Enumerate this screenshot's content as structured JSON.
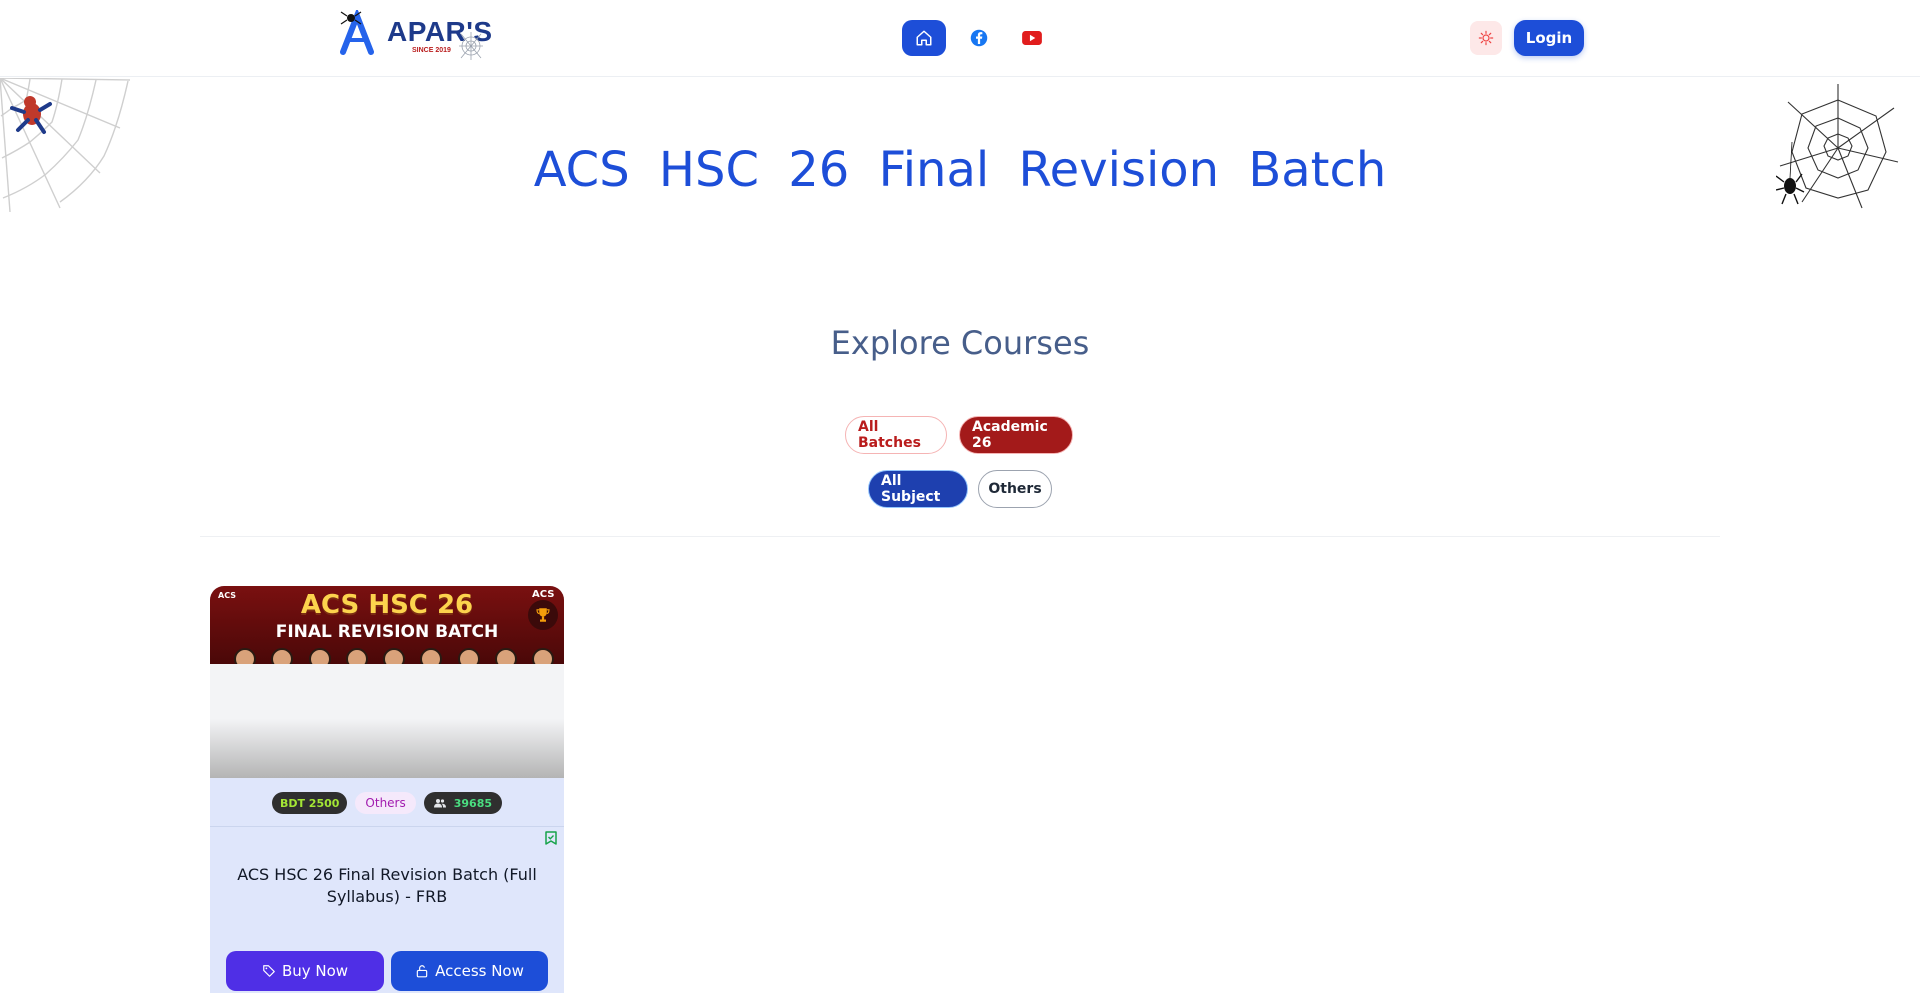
{
  "header": {
    "logo_text": "APAR'S",
    "logo_since": "SINCE 2019",
    "login_label": "Login",
    "nav_icons": [
      "home-icon",
      "facebook-icon",
      "youtube-icon"
    ],
    "theme_icon": "sun-icon"
  },
  "hero": {
    "title": "ACS HSC 26 Final Revision Batch"
  },
  "explore": {
    "title": "Explore Courses",
    "batch_filters": [
      {
        "label": "All Batches",
        "active": false
      },
      {
        "label": "Academic 26",
        "active": true
      }
    ],
    "subject_filters": [
      {
        "label": "All Subject",
        "active": true
      },
      {
        "label": "Others",
        "active": false
      }
    ]
  },
  "courses": [
    {
      "banner_line1": "ACS HSC 26",
      "banner_line2": "FINAL REVISION BATCH",
      "banner_brand": "ACS",
      "banner_corner": "ACS",
      "price": "BDT 2500",
      "category": "Others",
      "students": "39685",
      "title": "ACS HSC 26 Final Revision Batch (Full Syllabus) - FRB",
      "buy_label": "Buy Now",
      "access_label": "Access Now"
    }
  ],
  "colors": {
    "primary": "#1d4ed8",
    "accent_red": "#a31a1a",
    "buy_purple": "#4f2fe6",
    "card_bg": "#dfe6fb"
  }
}
